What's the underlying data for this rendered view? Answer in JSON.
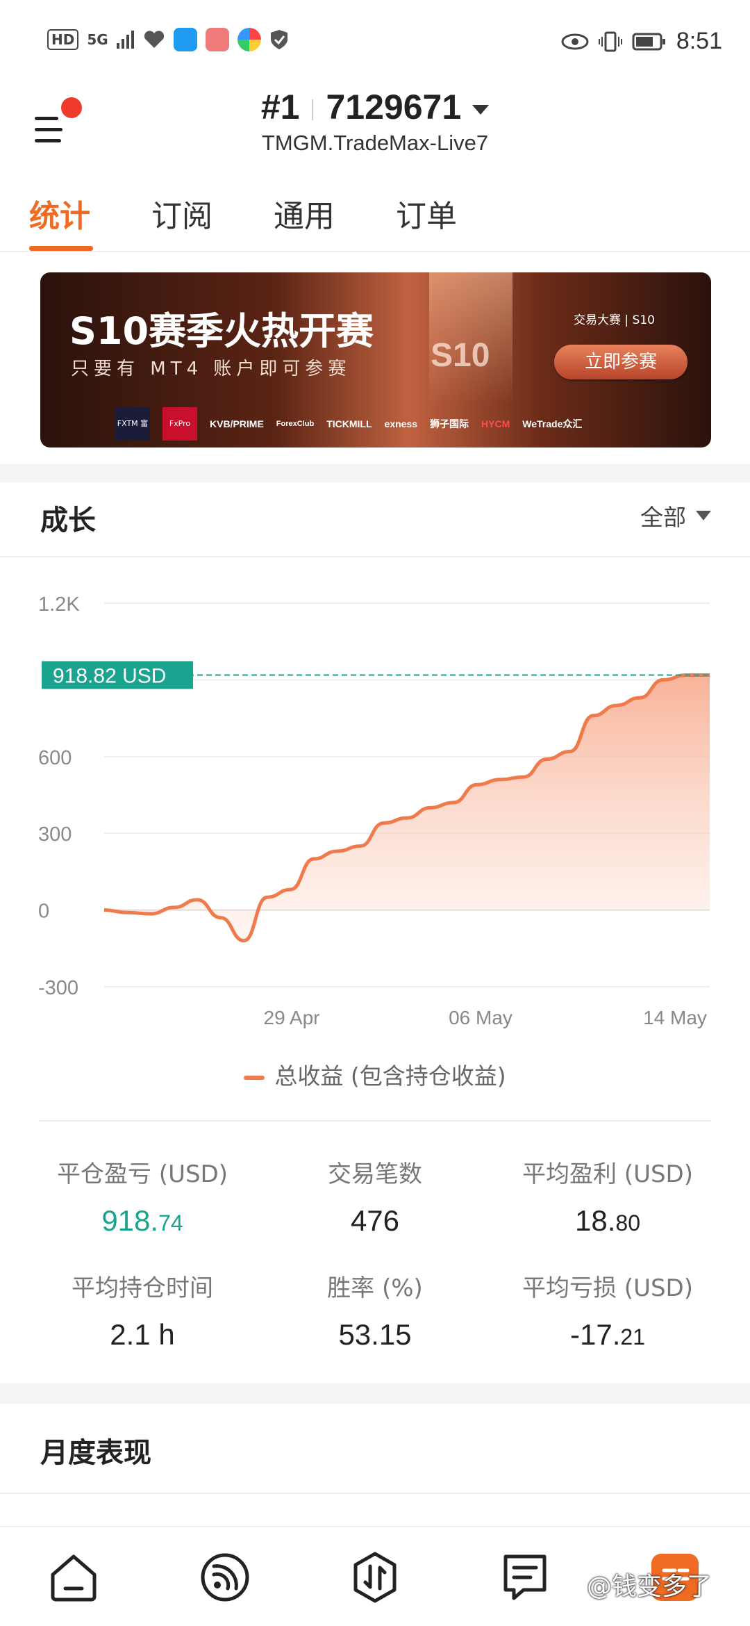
{
  "status_bar": {
    "hd": "HD",
    "network": "5G",
    "time": "8:51"
  },
  "header": {
    "account_rank": "#1",
    "account_number": "7129671",
    "server": "TMGM.TradeMax-Live7"
  },
  "tabs": [
    {
      "label": "统计",
      "active": true
    },
    {
      "label": "订阅",
      "active": false
    },
    {
      "label": "通用",
      "active": false
    },
    {
      "label": "订单",
      "active": false
    }
  ],
  "banner": {
    "title": "S10赛季火热开赛",
    "subtitle": "只要有 MT4 账户即可参赛",
    "brand": "交易大赛 | S10",
    "badge": "S10",
    "cta": "立即参赛",
    "sponsors": [
      "FXTM 富拓",
      "FxPro",
      "KVB/PRIME",
      "ForexClub",
      "TICKMILL",
      "exness",
      "狮子国际",
      "HYCM",
      "WeTrade众汇"
    ]
  },
  "growth": {
    "title": "成长",
    "range": "全部"
  },
  "chart_data": {
    "type": "area",
    "x_labels": [
      "29 Apr",
      "06 May",
      "14 May"
    ],
    "y_ticks": [
      "1.2K",
      "600",
      "300",
      "0",
      "-300"
    ],
    "ylim": [
      -300,
      1200
    ],
    "current_value_label": "918.82 USD",
    "current_value": 918.82,
    "series": [
      {
        "name": "总收益 (包含持仓收益)",
        "values": [
          0,
          -10,
          -15,
          10,
          40,
          -30,
          -120,
          50,
          80,
          200,
          230,
          250,
          340,
          360,
          400,
          420,
          490,
          510,
          520,
          590,
          620,
          760,
          800,
          830,
          900,
          918.82,
          918.82
        ]
      }
    ],
    "legend": "总收益 (包含持仓收益)",
    "grid": true,
    "colors": {
      "line": "#ef7a4c",
      "marker": "#1aa38f"
    }
  },
  "stats": [
    {
      "label": "平仓盈亏 (USD)",
      "value_main": "918.",
      "value_small": "74",
      "color": "green"
    },
    {
      "label": "交易笔数",
      "value_main": "476",
      "value_small": ""
    },
    {
      "label": "平均盈利 (USD)",
      "value_main": "18.",
      "value_small": "80"
    },
    {
      "label": "平均持仓时间",
      "value_main": "2.1 h",
      "value_small": ""
    },
    {
      "label": "胜率 (%)",
      "value_main": "53.15",
      "value_small": ""
    },
    {
      "label": "平均亏损 (USD)",
      "value_main": "-17.",
      "value_small": "21"
    }
  ],
  "monthly": {
    "title": "月度表现"
  },
  "bottom_nav": [
    "home-icon",
    "signal-icon",
    "trade-icon",
    "news-icon",
    "profile-icon"
  ],
  "watermark": "@钱变多了"
}
